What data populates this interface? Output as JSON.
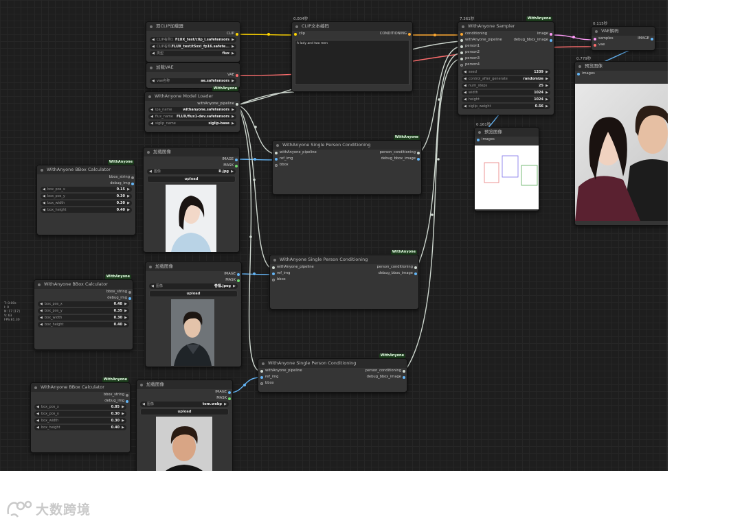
{
  "nodes": {
    "clip_loader": {
      "title": "双CLIP加载器",
      "out_clip": "CLIP",
      "w1_label": "CLIP名称1",
      "w1_value": "FLUX_test/clip_l.safetensors",
      "w2_label": "CLIP名称2",
      "w2_value": "FLUX_test/t5xxl_fp16.safete...",
      "w3_label": "类型",
      "w3_value": "flux"
    },
    "vae_loader": {
      "title": "加载VAE",
      "out_vae": "VAE",
      "w1_label": "vae名称",
      "w1_value": "ae.safetensors"
    },
    "clip_encode": {
      "timing": "0.004秒",
      "title": "CLIP文本编码",
      "in_clip": "clip",
      "out_cond": "CONDITIONING",
      "text": "A lady and two men"
    },
    "sampler": {
      "timing": "7.361秒",
      "badge": "WithAnyone",
      "title": "WithAnyone Sampler",
      "in1": "conditioning",
      "in2": "withAnyone_pipeline",
      "in3": "person1",
      "in4": "person2",
      "in5": "person3",
      "in6": "person4",
      "out1": "image",
      "out2": "debug_bbox_image",
      "w_seed_label": "seed",
      "w_seed": "1339",
      "w_ctrl_label": "control_after_generate",
      "w_ctrl": "randomize",
      "w_steps_label": "num_steps",
      "w_steps": "25",
      "w_width_label": "width",
      "w_width": "1024",
      "w_height_label": "height",
      "w_height": "1024",
      "w_siglip_label": "siglip_weight",
      "w_siglip": "0.56"
    },
    "vae_decode": {
      "timing": "0.115秒",
      "title": "VAE解码",
      "in1": "samples",
      "in2": "vae",
      "out": "IMAGE"
    },
    "preview_big": {
      "timing": "0.779秒",
      "title": "预览图像",
      "in": "images"
    },
    "model_loader": {
      "badge": "WithAnyone",
      "title": "WithAnyone Model Loader",
      "out": "withAnyone_pipeline",
      "w1_label": "ipa_name",
      "w1_value": "withanyone.safetensors",
      "w2_label": "flux_name",
      "w2_value": "FLUX/flux1-dev.safetensors",
      "w3_label": "siglip_name",
      "w3_value": "siglip-base"
    },
    "preview_small": {
      "timing": "0.161秒",
      "title": "预览图像",
      "in": "images"
    },
    "load_img1": {
      "title": "加载图像",
      "out1": "IMAGE",
      "out2": "MASK",
      "w_label": "图像",
      "w_value": "R.jpg",
      "upload": "upload"
    },
    "load_img2": {
      "title": "加载图像",
      "out1": "IMAGE",
      "out2": "MASK",
      "w_label": "图像",
      "w_value": "卷福.jpeg",
      "upload": "upload"
    },
    "load_img3": {
      "title": "加载图像",
      "out1": "IMAGE",
      "out2": "MASK",
      "w_label": "图像",
      "w_value": "tom.webp",
      "upload": "upload"
    },
    "cond1": {
      "badge": "WithAnyone",
      "title": "WithAnyone Single Person Conditioning",
      "in1": "withAnyone_pipeline",
      "in2": "ref_img",
      "in3": "bbox",
      "out1": "person_conditioning",
      "out2": "debug_bbox_image"
    },
    "cond2": {
      "badge": "WithAnyone",
      "title": "WithAnyone Single Person Conditioning",
      "in1": "withAnyone_pipeline",
      "in2": "ref_img",
      "in3": "bbox",
      "out1": "person_conditioning",
      "out2": "debug_bbox_image"
    },
    "cond3": {
      "badge": "WithAnyone",
      "title": "WithAnyone Single Person Conditioning",
      "in1": "withAnyone_pipeline",
      "in2": "ref_img",
      "in3": "bbox",
      "out1": "person_conditioning",
      "out2": "debug_bbox_image"
    },
    "bbox1": {
      "badge": "WithAnyone",
      "title": "WithAnyone BBox Calculator",
      "out1": "bbox_string",
      "out2": "debug_img",
      "l1": "box_pos_x",
      "v1": "0.15",
      "l2": "box_pos_y",
      "v2": "0.30",
      "l3": "box_width",
      "v3": "0.30",
      "l4": "box_height",
      "v4": "0.40"
    },
    "bbox2": {
      "badge": "WithAnyone",
      "title": "WithAnyone BBox Calculator",
      "out1": "bbox_string",
      "out2": "debug_img",
      "l1": "box_pos_x",
      "v1": "0.48",
      "l2": "box_pos_y",
      "v2": "0.35",
      "l3": "box_width",
      "v3": "0.30",
      "l4": "box_height",
      "v4": "0.40"
    },
    "bbox3": {
      "badge": "WithAnyone",
      "title": "WithAnyone BBox Calculator",
      "out1": "bbox_string",
      "out2": "debug_img",
      "l1": "box_pos_x",
      "v1": "0.85",
      "l2": "box_pos_y",
      "v2": "0.30",
      "l3": "box_width",
      "v3": "0.30",
      "l4": "box_height",
      "v4": "0.40"
    }
  },
  "stats": [
    "T: 0.00s",
    "I: 0",
    "N: 17 [17]",
    "V: 63",
    "FPS:81.30"
  ],
  "watermark": "大数跨境",
  "colors": {
    "clip": "#ffd500",
    "vae": "#ff6e6e",
    "conditioning": "#ffa931",
    "image": "#64b5f6",
    "pipeline": "#cfd8d0",
    "latent": "#ff9cf9"
  }
}
